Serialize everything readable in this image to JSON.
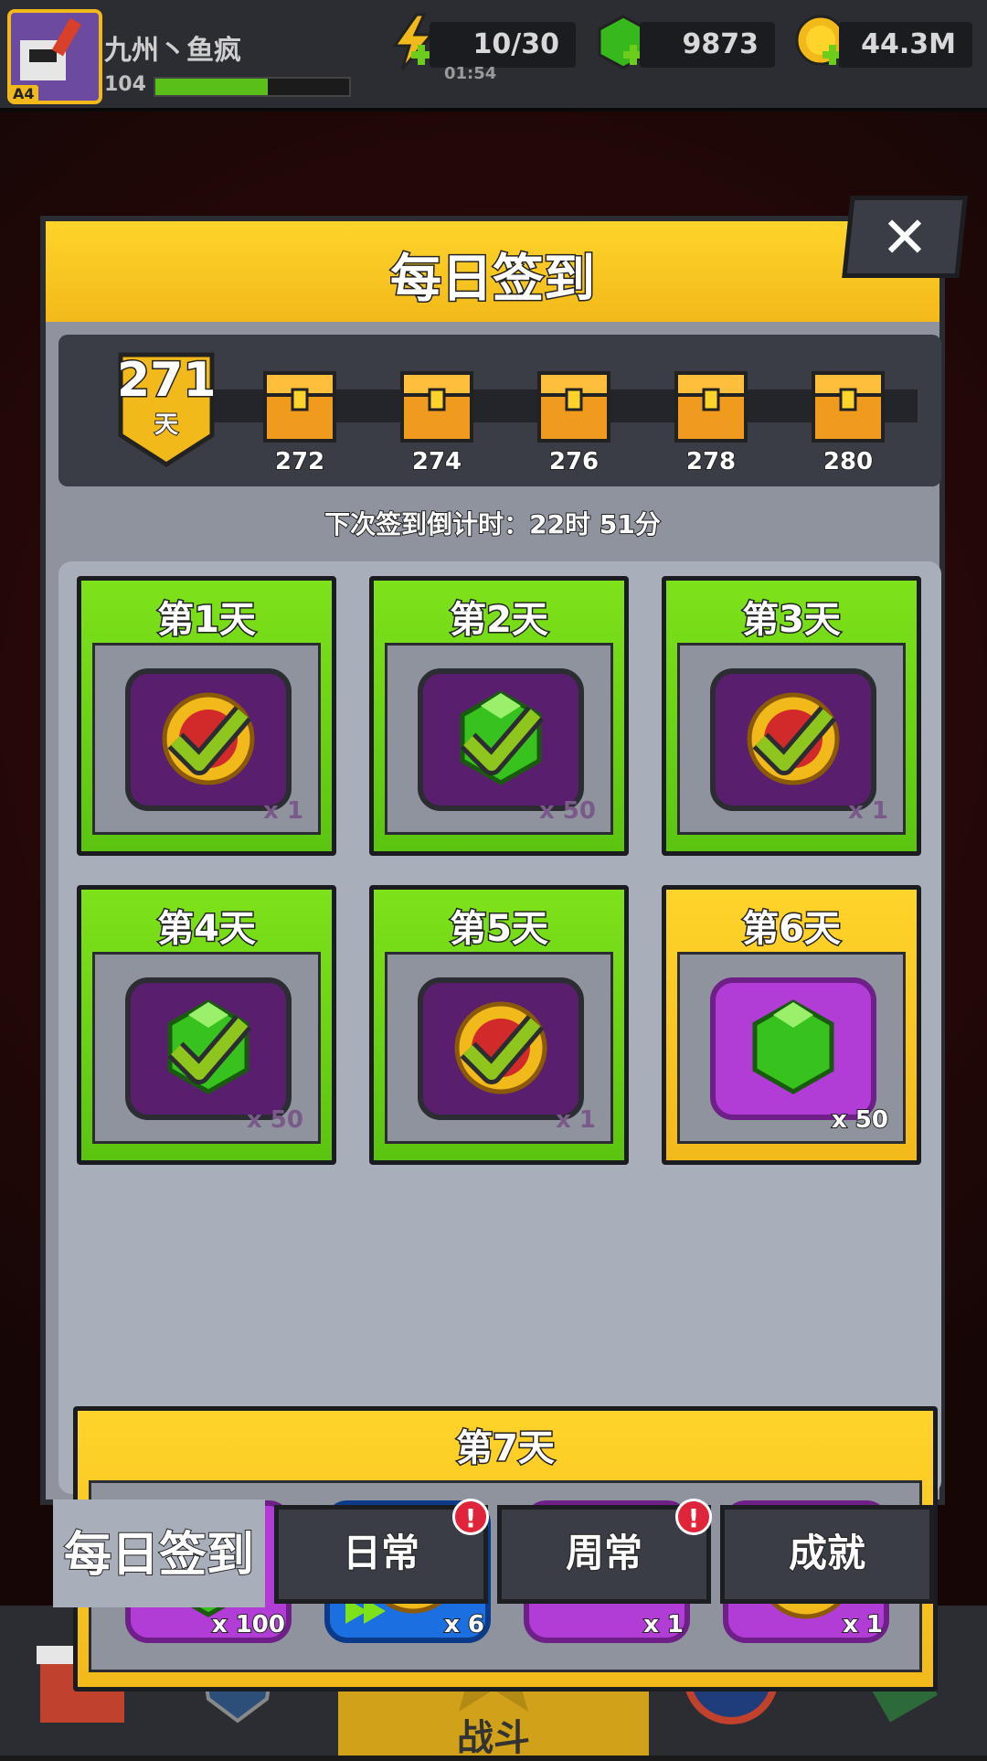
{
  "player": {
    "name": "九州丶鱼疯",
    "level_badge": "A4",
    "exp_value": "104",
    "exp_fill": 0.58
  },
  "resources": {
    "energy": {
      "icon": "lightning-icon",
      "value": "10/30",
      "timer": "01:54"
    },
    "gems": {
      "icon": "gem-icon",
      "value": "9873"
    },
    "coins": {
      "icon": "coin-icon",
      "value": "44.3M"
    }
  },
  "dialog": {
    "title": "每日签到",
    "close_icon": "close-icon",
    "progress": {
      "current_day": "271",
      "day_unit": "天",
      "milestones": [
        "272",
        "274",
        "276",
        "278",
        "280"
      ]
    },
    "countdown": "下次签到倒计时：22时 51分",
    "days": [
      {
        "label": "第1天",
        "item": "coin-icon",
        "qty": "x 1",
        "state": "claimed"
      },
      {
        "label": "第2天",
        "item": "gem-icon",
        "qty": "x 50",
        "state": "claimed"
      },
      {
        "label": "第3天",
        "item": "coin-icon",
        "qty": "x 1",
        "state": "claimed"
      },
      {
        "label": "第4天",
        "item": "gem-icon",
        "qty": "x 50",
        "state": "claimed"
      },
      {
        "label": "第5天",
        "item": "coin-icon",
        "qty": "x 1",
        "state": "claimed"
      },
      {
        "label": "第6天",
        "item": "gem-icon",
        "qty": "x 50",
        "state": "today"
      }
    ],
    "day7": {
      "label": "第7天",
      "rewards": [
        {
          "item": "gem-icon",
          "qty": "x 100"
        },
        {
          "item": "coin-fastforward-icon",
          "qty": "x 6"
        },
        {
          "item": "key-icon",
          "qty": "x 1"
        },
        {
          "item": "heart-coin-icon",
          "qty": "x 1"
        }
      ]
    }
  },
  "tabs": [
    {
      "label": "每日签到",
      "active": true,
      "alert": false
    },
    {
      "label": "日常",
      "active": false,
      "alert": true
    },
    {
      "label": "周常",
      "active": false,
      "alert": true
    },
    {
      "label": "成就",
      "active": false,
      "alert": false
    }
  ],
  "alert_glyph": "!",
  "bottom_nav": {
    "battle_label": "战斗"
  },
  "colors": {
    "claimed": "#7ee21a",
    "today": "#f2b91a",
    "alert": "#e0243a"
  }
}
